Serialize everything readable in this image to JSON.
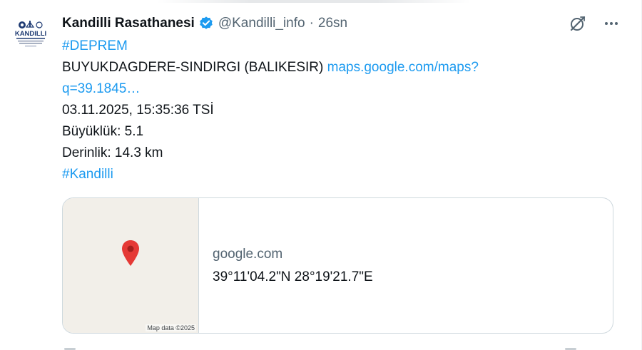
{
  "author": {
    "display_name": "Kandilli Rasathanesi",
    "handle": "@Kandilli_info",
    "separator": "·",
    "time": "26sn",
    "avatar_text": "KANDILLI"
  },
  "tweet": {
    "hashtag_1": "#DEPREM",
    "location": "BUYUKDAGDERE-SINDIRGI (BALIKESIR)",
    "link_part_1": "maps.google.com/maps?",
    "link_part_2": "q=39.1845…",
    "datetime": "03.11.2025, 15:35:36 TSİ",
    "magnitude": "Büyüklük: 5.1",
    "depth": "Derinlik: 14.3 km",
    "hashtag_2": "#Kandilli"
  },
  "card": {
    "domain": "google.com",
    "title": "39°11'04.2\"N 28°19'21.7\"E",
    "map_attribution": "Map data ©2025"
  },
  "icons": {
    "verified": "verified-badge-icon",
    "grok": "grok-icon",
    "more": "more-icon",
    "pin": "map-pin-icon"
  },
  "colors": {
    "link": "#1d9bf0",
    "secondary_text": "#536471",
    "primary_text": "#0f1419",
    "card_border": "#cfd9de",
    "map_background": "#f2efe9",
    "pin": "#e53935"
  }
}
